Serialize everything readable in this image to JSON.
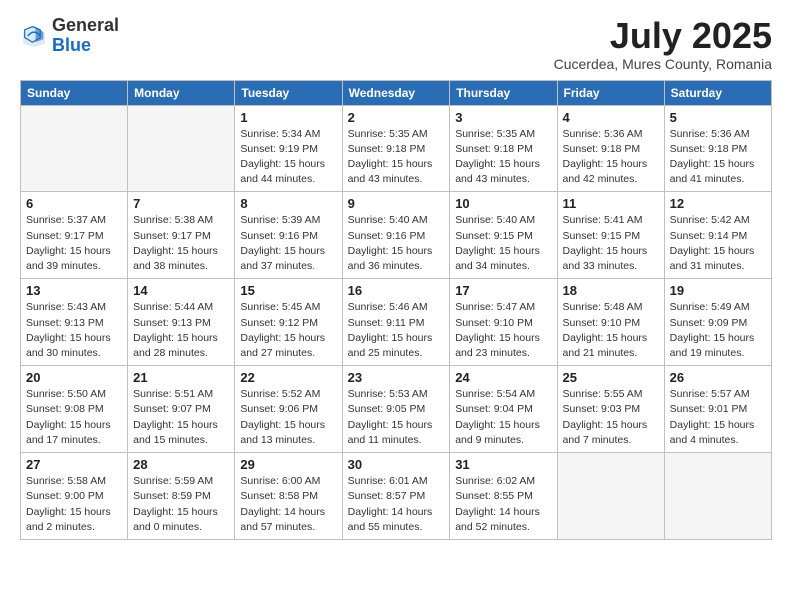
{
  "logo": {
    "general": "General",
    "blue": "Blue"
  },
  "header": {
    "month": "July 2025",
    "location": "Cucerdea, Mures County, Romania"
  },
  "weekdays": [
    "Sunday",
    "Monday",
    "Tuesday",
    "Wednesday",
    "Thursday",
    "Friday",
    "Saturday"
  ],
  "weeks": [
    [
      {
        "day": "",
        "info": ""
      },
      {
        "day": "",
        "info": ""
      },
      {
        "day": "1",
        "info": "Sunrise: 5:34 AM\nSunset: 9:19 PM\nDaylight: 15 hours\nand 44 minutes."
      },
      {
        "day": "2",
        "info": "Sunrise: 5:35 AM\nSunset: 9:18 PM\nDaylight: 15 hours\nand 43 minutes."
      },
      {
        "day": "3",
        "info": "Sunrise: 5:35 AM\nSunset: 9:18 PM\nDaylight: 15 hours\nand 43 minutes."
      },
      {
        "day": "4",
        "info": "Sunrise: 5:36 AM\nSunset: 9:18 PM\nDaylight: 15 hours\nand 42 minutes."
      },
      {
        "day": "5",
        "info": "Sunrise: 5:36 AM\nSunset: 9:18 PM\nDaylight: 15 hours\nand 41 minutes."
      }
    ],
    [
      {
        "day": "6",
        "info": "Sunrise: 5:37 AM\nSunset: 9:17 PM\nDaylight: 15 hours\nand 39 minutes."
      },
      {
        "day": "7",
        "info": "Sunrise: 5:38 AM\nSunset: 9:17 PM\nDaylight: 15 hours\nand 38 minutes."
      },
      {
        "day": "8",
        "info": "Sunrise: 5:39 AM\nSunset: 9:16 PM\nDaylight: 15 hours\nand 37 minutes."
      },
      {
        "day": "9",
        "info": "Sunrise: 5:40 AM\nSunset: 9:16 PM\nDaylight: 15 hours\nand 36 minutes."
      },
      {
        "day": "10",
        "info": "Sunrise: 5:40 AM\nSunset: 9:15 PM\nDaylight: 15 hours\nand 34 minutes."
      },
      {
        "day": "11",
        "info": "Sunrise: 5:41 AM\nSunset: 9:15 PM\nDaylight: 15 hours\nand 33 minutes."
      },
      {
        "day": "12",
        "info": "Sunrise: 5:42 AM\nSunset: 9:14 PM\nDaylight: 15 hours\nand 31 minutes."
      }
    ],
    [
      {
        "day": "13",
        "info": "Sunrise: 5:43 AM\nSunset: 9:13 PM\nDaylight: 15 hours\nand 30 minutes."
      },
      {
        "day": "14",
        "info": "Sunrise: 5:44 AM\nSunset: 9:13 PM\nDaylight: 15 hours\nand 28 minutes."
      },
      {
        "day": "15",
        "info": "Sunrise: 5:45 AM\nSunset: 9:12 PM\nDaylight: 15 hours\nand 27 minutes."
      },
      {
        "day": "16",
        "info": "Sunrise: 5:46 AM\nSunset: 9:11 PM\nDaylight: 15 hours\nand 25 minutes."
      },
      {
        "day": "17",
        "info": "Sunrise: 5:47 AM\nSunset: 9:10 PM\nDaylight: 15 hours\nand 23 minutes."
      },
      {
        "day": "18",
        "info": "Sunrise: 5:48 AM\nSunset: 9:10 PM\nDaylight: 15 hours\nand 21 minutes."
      },
      {
        "day": "19",
        "info": "Sunrise: 5:49 AM\nSunset: 9:09 PM\nDaylight: 15 hours\nand 19 minutes."
      }
    ],
    [
      {
        "day": "20",
        "info": "Sunrise: 5:50 AM\nSunset: 9:08 PM\nDaylight: 15 hours\nand 17 minutes."
      },
      {
        "day": "21",
        "info": "Sunrise: 5:51 AM\nSunset: 9:07 PM\nDaylight: 15 hours\nand 15 minutes."
      },
      {
        "day": "22",
        "info": "Sunrise: 5:52 AM\nSunset: 9:06 PM\nDaylight: 15 hours\nand 13 minutes."
      },
      {
        "day": "23",
        "info": "Sunrise: 5:53 AM\nSunset: 9:05 PM\nDaylight: 15 hours\nand 11 minutes."
      },
      {
        "day": "24",
        "info": "Sunrise: 5:54 AM\nSunset: 9:04 PM\nDaylight: 15 hours\nand 9 minutes."
      },
      {
        "day": "25",
        "info": "Sunrise: 5:55 AM\nSunset: 9:03 PM\nDaylight: 15 hours\nand 7 minutes."
      },
      {
        "day": "26",
        "info": "Sunrise: 5:57 AM\nSunset: 9:01 PM\nDaylight: 15 hours\nand 4 minutes."
      }
    ],
    [
      {
        "day": "27",
        "info": "Sunrise: 5:58 AM\nSunset: 9:00 PM\nDaylight: 15 hours\nand 2 minutes."
      },
      {
        "day": "28",
        "info": "Sunrise: 5:59 AM\nSunset: 8:59 PM\nDaylight: 15 hours\nand 0 minutes."
      },
      {
        "day": "29",
        "info": "Sunrise: 6:00 AM\nSunset: 8:58 PM\nDaylight: 14 hours\nand 57 minutes."
      },
      {
        "day": "30",
        "info": "Sunrise: 6:01 AM\nSunset: 8:57 PM\nDaylight: 14 hours\nand 55 minutes."
      },
      {
        "day": "31",
        "info": "Sunrise: 6:02 AM\nSunset: 8:55 PM\nDaylight: 14 hours\nand 52 minutes."
      },
      {
        "day": "",
        "info": ""
      },
      {
        "day": "",
        "info": ""
      }
    ]
  ]
}
